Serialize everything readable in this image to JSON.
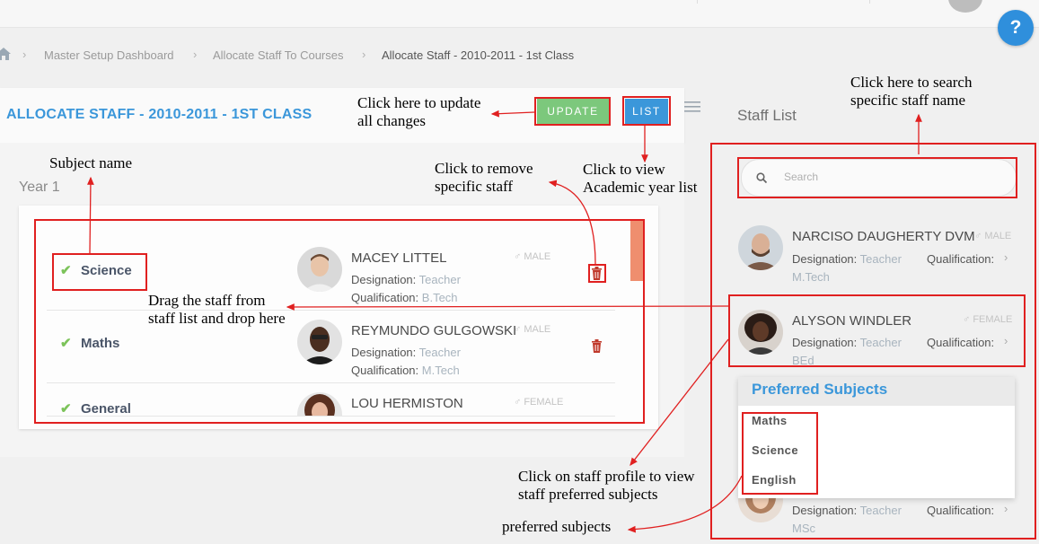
{
  "breadcrumb": {
    "items": [
      "Master Setup Dashboard",
      "Allocate Staff To Courses"
    ],
    "current": "Allocate Staff - 2010-2011 - 1st Class"
  },
  "help_label": "?",
  "header": {
    "title": "ALLOCATE STAFF - 2010-2011 - 1ST CLASS",
    "update_label": "UPDATE",
    "list_label": "LIST"
  },
  "year_label": "Year 1",
  "subjects": [
    {
      "name": "Science",
      "staff": {
        "name": "MACEY LITTEL",
        "gender": "MALE",
        "designation_label": "Designation:",
        "designation": "Teacher",
        "qualification_label": "Qualification:",
        "qualification": "B.Tech"
      }
    },
    {
      "name": "Maths",
      "staff": {
        "name": "REYMUNDO GULGOWSKI",
        "gender": "MALE",
        "designation_label": "Designation:",
        "designation": "Teacher",
        "qualification_label": "Qualification:",
        "qualification": "M.Tech"
      }
    },
    {
      "name": "General",
      "staff": {
        "name": "LOU HERMISTON",
        "gender": "FEMALE"
      }
    }
  ],
  "staff_list": {
    "title": "Staff List",
    "search_placeholder": "Search",
    "items": [
      {
        "name": "NARCISO DAUGHERTY DVM",
        "gender": "MALE",
        "designation_label": "Designation:",
        "designation": "Teacher",
        "qualification_label": "Qualification:",
        "qualification": "M.Tech"
      },
      {
        "name": "ALYSON WINDLER",
        "gender": "FEMALE",
        "designation_label": "Designation:",
        "designation": "Teacher",
        "qualification_label": "Qualification:",
        "qualification": "BEd"
      },
      {
        "designation_label": "Designation:",
        "designation": "Teacher",
        "qualification_label": "Qualification:",
        "qualification": "MSc"
      }
    ]
  },
  "preferred_subjects": {
    "title": "Preferred Subjects",
    "items": [
      "Maths",
      "Science",
      "English"
    ]
  },
  "annotations": {
    "update": "Click here to update\nall changes",
    "subject_name": "Subject name",
    "remove_staff": "Click to remove\nspecific staff",
    "view_list": "Click to view\nAcademic year list",
    "search": "Click here to search\nspecific staff name",
    "drag": "Drag the staff from\nstaff list and drop here",
    "profile": "Click on staff profile to view\nstaff preferred subjects",
    "preferred": "preferred subjects"
  },
  "colors": {
    "accent": "#3b97da",
    "update_button": "#7cc87c",
    "annotation_red": "#e02020",
    "check_green": "#7cc35a",
    "scroll_thumb": "#ef8e6e"
  }
}
